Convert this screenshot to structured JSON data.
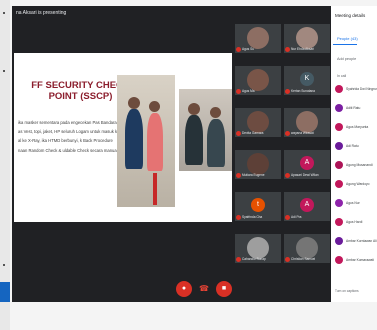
{
  "presenting_banner": "na Aksari is presenting",
  "slide": {
    "title": "FF SECURITY CHECK POINT (SSCP)",
    "bullets": [
      "ika masker sementara pada engecekan Pas Bandara",
      "as Vest, topi, jaket, HP seluruh Logam untuk masuk ke x-ray",
      "al ke X-Ray, ika HTMD berbunyi, k Back Procedure",
      "naan Random Check & uldable Check secara manual TD"
    ]
  },
  "participants": [
    {
      "label": "Agus Su",
      "kind": "cam",
      "color": "#8d6e63"
    },
    {
      "label": "Nur Ehda Aksari",
      "kind": "cam",
      "color": "#a1887f"
    },
    {
      "label": "Agus Ma",
      "kind": "cam",
      "color": "#795548"
    },
    {
      "label": "Kertan Sunatana",
      "kind": "avatar",
      "initial": "K",
      "color": "#455a64"
    },
    {
      "label": "Devita Gamara",
      "kind": "cam",
      "color": "#6d4c41"
    },
    {
      "label": "wayana Wirasat",
      "kind": "cam",
      "color": "#8d6e63"
    },
    {
      "label": "Mutiara Eugene",
      "kind": "cam",
      "color": "#5d4037"
    },
    {
      "label": "Apasari Dewi Wilan",
      "kind": "avatar",
      "initial": "A",
      "color": "#c2185b"
    },
    {
      "label": "Syafrinda Cha",
      "kind": "avatar",
      "initial": "t",
      "color": "#e65100"
    },
    {
      "label": "Adi Pra",
      "kind": "avatar",
      "initial": "A",
      "color": "#c2185b"
    },
    {
      "label": "Cahandio Sunap",
      "kind": "cam",
      "color": "#9e9e9e"
    },
    {
      "label": "Christian Samuel",
      "kind": "cam",
      "color": "#757575"
    }
  ],
  "controls": {
    "mic_icon": "mic-off-icon",
    "hangup_icon": "hangup-icon",
    "camera_icon": "camera-off-icon"
  },
  "panel": {
    "title": "Meeting details",
    "tab_label": "People (43)",
    "add_label": "Add people",
    "section_label": "In call",
    "people": [
      {
        "name": "Syahrida Dwi Ningrum",
        "color": "#c2185b"
      },
      {
        "name": "Aditi Ratu",
        "color": "#7b1fa2"
      },
      {
        "name": "Agus Maryunta",
        "color": "#c2185b"
      },
      {
        "name": "Adi Ratu",
        "color": "#6a1b9a"
      },
      {
        "name": "Agung Musanandi",
        "color": "#ad1457"
      },
      {
        "name": "Agung Wardoyo",
        "color": "#c2185b"
      },
      {
        "name": "Agus Nur",
        "color": "#8e24aa"
      },
      {
        "name": "Agus Hardi",
        "color": "#c2185b"
      },
      {
        "name": "Ambar Kurniawan Ali",
        "color": "#6a1b9a"
      },
      {
        "name": "Ambar Kumarawati",
        "color": "#c2185b"
      }
    ],
    "footer_label": "Turn on captions"
  }
}
